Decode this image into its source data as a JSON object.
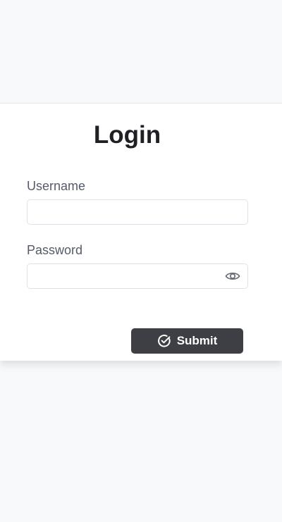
{
  "form": {
    "title": "Login",
    "username_label": "Username",
    "username_value": "",
    "password_label": "Password",
    "password_value": "",
    "password_toggle_icon": "eye-icon",
    "submit_label": "Submit",
    "submit_icon": "check-circle-icon"
  },
  "colors": {
    "page_background": "#f8f9fb",
    "card_background": "#ffffff",
    "button_background": "#3e3f44",
    "label_text": "#555b66",
    "title_text": "#1f2024"
  }
}
